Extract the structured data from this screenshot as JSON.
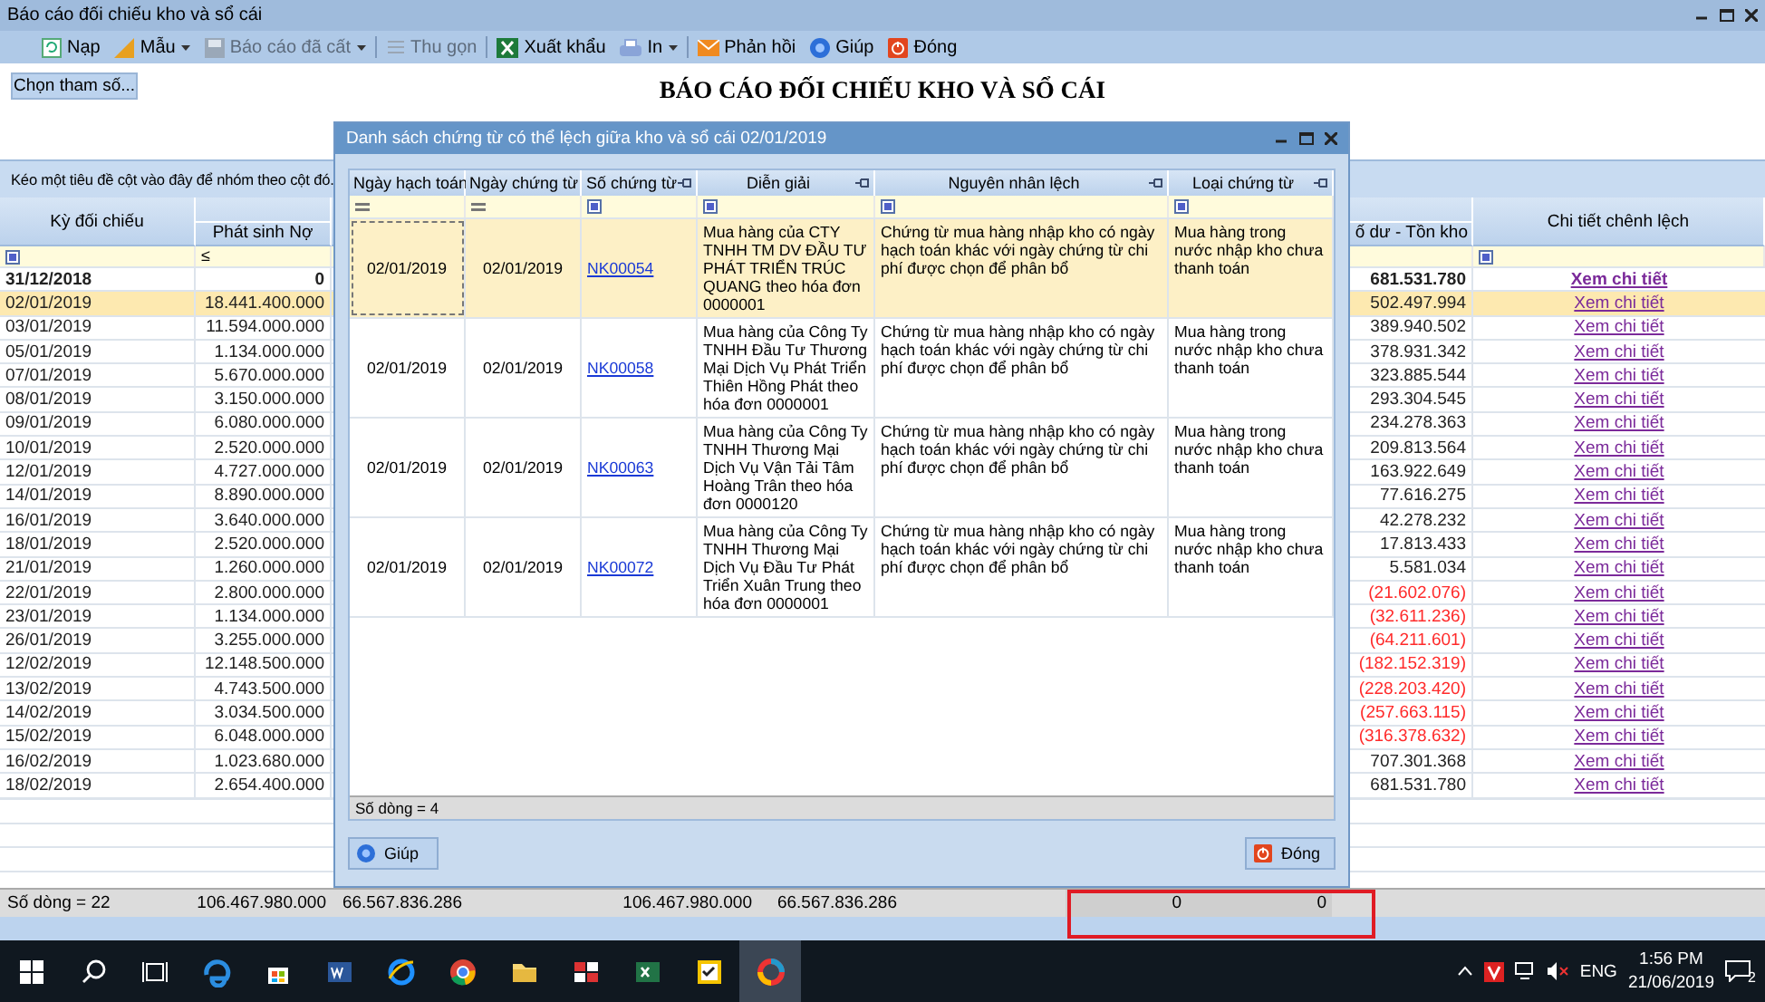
{
  "window": {
    "title": "Báo cáo đối chiếu kho và sổ cái"
  },
  "toolbar": [
    {
      "label": "Nạp",
      "disabled": false,
      "dropdown": false
    },
    {
      "label": "Mẫu",
      "disabled": false,
      "dropdown": true
    },
    {
      "label": "Báo cáo đã cất",
      "disabled": true,
      "dropdown": true
    },
    {
      "label": "Thu gọn",
      "disabled": true,
      "dropdown": false
    },
    {
      "label": "Xuất khẩu",
      "disabled": false,
      "dropdown": false
    },
    {
      "label": "In",
      "disabled": false,
      "dropdown": true
    },
    {
      "label": "Phản hồi",
      "disabled": false,
      "dropdown": false
    },
    {
      "label": "Giúp",
      "disabled": false,
      "dropdown": false
    },
    {
      "label": "Đóng",
      "disabled": false,
      "dropdown": false
    }
  ],
  "parameters_button": "Chọn tham số...",
  "report_title": "BÁO CÁO ĐỐI CHIẾU KHO VÀ SỔ CÁI",
  "group_panel": "Kéo một tiêu đề cột vào đây để nhóm theo cột đó.",
  "grid": {
    "columns": [
      "Kỳ đối chiếu",
      "Phát sinh Nợ",
      "ố dư - Tồn kho",
      "Chi tiết chênh lệch"
    ],
    "debit_filter": "≤",
    "rows": [
      {
        "kind": "opening",
        "period": "31/12/2018",
        "debit": "0",
        "balance": "681.531.780",
        "negative": false,
        "link": "Xem chi tiết",
        "selected": false
      },
      {
        "kind": "day",
        "period": "02/01/2019",
        "debit": "18.441.400.000",
        "balance": "502.497.994",
        "negative": false,
        "link": "Xem chi tiết",
        "selected": true
      },
      {
        "kind": "day",
        "period": "03/01/2019",
        "debit": "11.594.000.000",
        "balance": "389.940.502",
        "negative": false,
        "link": "Xem chi tiết",
        "selected": false
      },
      {
        "kind": "day",
        "period": "05/01/2019",
        "debit": "1.134.000.000",
        "balance": "378.931.342",
        "negative": false,
        "link": "Xem chi tiết",
        "selected": false
      },
      {
        "kind": "day",
        "period": "07/01/2019",
        "debit": "5.670.000.000",
        "balance": "323.885.544",
        "negative": false,
        "link": "Xem chi tiết",
        "selected": false
      },
      {
        "kind": "day",
        "period": "08/01/2019",
        "debit": "3.150.000.000",
        "balance": "293.304.545",
        "negative": false,
        "link": "Xem chi tiết",
        "selected": false
      },
      {
        "kind": "day",
        "period": "09/01/2019",
        "debit": "6.080.000.000",
        "balance": "234.278.363",
        "negative": false,
        "link": "Xem chi tiết",
        "selected": false
      },
      {
        "kind": "day",
        "period": "10/01/2019",
        "debit": "2.520.000.000",
        "balance": "209.813.564",
        "negative": false,
        "link": "Xem chi tiết",
        "selected": false
      },
      {
        "kind": "day",
        "period": "12/01/2019",
        "debit": "4.727.000.000",
        "balance": "163.922.649",
        "negative": false,
        "link": "Xem chi tiết",
        "selected": false
      },
      {
        "kind": "day",
        "period": "14/01/2019",
        "debit": "8.890.000.000",
        "balance": "77.616.275",
        "negative": false,
        "link": "Xem chi tiết",
        "selected": false
      },
      {
        "kind": "day",
        "period": "16/01/2019",
        "debit": "3.640.000.000",
        "balance": "42.278.232",
        "negative": false,
        "link": "Xem chi tiết",
        "selected": false
      },
      {
        "kind": "day",
        "period": "18/01/2019",
        "debit": "2.520.000.000",
        "balance": "17.813.433",
        "negative": false,
        "link": "Xem chi tiết",
        "selected": false
      },
      {
        "kind": "day",
        "period": "21/01/2019",
        "debit": "1.260.000.000",
        "balance": "5.581.034",
        "negative": false,
        "link": "Xem chi tiết",
        "selected": false
      },
      {
        "kind": "day",
        "period": "22/01/2019",
        "debit": "2.800.000.000",
        "balance": "(21.602.076)",
        "negative": true,
        "link": "Xem chi tiết",
        "selected": false
      },
      {
        "kind": "day",
        "period": "23/01/2019",
        "debit": "1.134.000.000",
        "balance": "(32.611.236)",
        "negative": true,
        "link": "Xem chi tiết",
        "selected": false
      },
      {
        "kind": "day",
        "period": "26/01/2019",
        "debit": "3.255.000.000",
        "balance": "(64.211.601)",
        "negative": true,
        "link": "Xem chi tiết",
        "selected": false
      },
      {
        "kind": "day",
        "period": "12/02/2019",
        "debit": "12.148.500.000",
        "balance": "(182.152.319)",
        "negative": true,
        "link": "Xem chi tiết",
        "selected": false
      },
      {
        "kind": "day",
        "period": "13/02/2019",
        "debit": "4.743.500.000",
        "balance": "(228.203.420)",
        "negative": true,
        "link": "Xem chi tiết",
        "selected": false
      },
      {
        "kind": "day",
        "period": "14/02/2019",
        "debit": "3.034.500.000",
        "balance": "(257.663.115)",
        "negative": true,
        "link": "Xem chi tiết",
        "selected": false
      },
      {
        "kind": "day",
        "period": "15/02/2019",
        "debit": "6.048.000.000",
        "balance": "(316.378.632)",
        "negative": true,
        "link": "Xem chi tiết",
        "selected": false
      },
      {
        "kind": "day",
        "period": "16/02/2019",
        "debit": "1.023.680.000",
        "balance": "707.301.368",
        "negative": false,
        "link": "Xem chi tiết",
        "selected": false
      },
      {
        "kind": "day",
        "period": "18/02/2019",
        "debit": "2.654.400.000",
        "balance": "681.531.780",
        "negative": false,
        "link": "Xem chi tiết",
        "selected": false
      }
    ]
  },
  "footer": {
    "count": "Số dòng = 22",
    "totals": [
      "106.467.980.000",
      "66.567.836.286",
      "106.467.980.000",
      "66.567.836.286",
      "0",
      "0"
    ]
  },
  "dialog": {
    "title": "Danh sách chứng từ có thể lệch giữa kho và sổ cái 02/01/2019",
    "columns": [
      "Ngày hạch toán",
      "Ngày chứng từ",
      "Số chứng từ",
      "Diễn giải",
      "Nguyên nhân lệch",
      "Loại chứng từ"
    ],
    "rows": [
      {
        "posting_date": "02/01/2019",
        "voucher_date": "02/01/2019",
        "voucher_no": "NK00054",
        "description": "Mua hàng của CTY TNHH TM DV ĐẦU TƯ PHÁT TRIỂN TRÚC QUANG theo hóa đơn 0000001",
        "reason": "Chứng từ mua hàng nhập kho có ngày hạch toán khác với ngày chứng từ chi phí được chọn để phân bổ",
        "voucher_type": "Mua hàng trong nước nhập kho chưa thanh toán",
        "selected": true
      },
      {
        "posting_date": "02/01/2019",
        "voucher_date": "02/01/2019",
        "voucher_no": "NK00058",
        "description": "Mua hàng của Công Ty TNHH Đầu Tư Thương Mại Dịch Vụ Phát Triển Thiên Hồng Phát theo hóa đơn 0000001",
        "reason": "Chứng từ mua hàng nhập kho có ngày hạch toán khác với ngày chứng từ chi phí được chọn để phân bổ",
        "voucher_type": "Mua hàng trong nước nhập kho chưa thanh toán",
        "selected": false
      },
      {
        "posting_date": "02/01/2019",
        "voucher_date": "02/01/2019",
        "voucher_no": "NK00063",
        "description": "Mua hàng của Công Ty TNHH Thương Mại Dịch Vụ Vận Tải Tâm Hoàng Trân theo hóa đơn 0000120",
        "reason": "Chứng từ mua hàng nhập kho có ngày hạch toán khác với ngày chứng từ chi phí được chọn để phân bổ",
        "voucher_type": "Mua hàng trong nước nhập kho chưa thanh toán",
        "selected": false
      },
      {
        "posting_date": "02/01/2019",
        "voucher_date": "02/01/2019",
        "voucher_no": "NK00072",
        "description": "Mua hàng của Công Ty TNHH Thương Mại Dịch Vụ Đầu Tư Phát Triển Xuân Trung theo hóa đơn 0000001",
        "reason": "Chứng từ mua hàng nhập kho có ngày hạch toán khác với ngày chứng từ chi phí được chọn để phân bổ",
        "voucher_type": "Mua hàng trong nước nhập kho chưa thanh toán",
        "selected": false
      }
    ],
    "count": "Số dòng = 4",
    "buttons": [
      "Giúp",
      "Đóng"
    ]
  },
  "taskbar": {
    "language": "ENG",
    "time": "1:56 PM",
    "date": "21/06/2019",
    "notifications": "2"
  }
}
